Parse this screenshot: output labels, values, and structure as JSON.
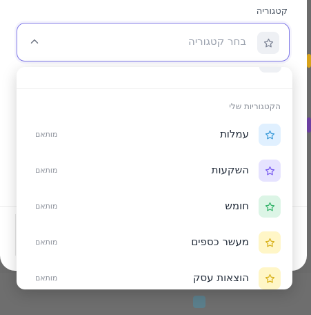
{
  "form": {
    "category_label": "קטגוריה",
    "placeholder": "בחר קטגוריה",
    "placeholder_icon": "star-icon",
    "chevron_icon": "chevron-up-icon",
    "accent_color": "#7b74e6"
  },
  "dropdown": {
    "section_title": "הקטגוריות שלי",
    "items": [
      {
        "label": "עמלות",
        "tag": "מותאם",
        "icon": "star-icon",
        "tile_color": "#e0f0ff",
        "star_color": "#3b9bd9"
      },
      {
        "label": "השקעות",
        "tag": "מותאם",
        "icon": "star-icon",
        "tile_color": "#e6e3ff",
        "star_color": "#7a5cf0"
      },
      {
        "label": "חומש",
        "tag": "מותאם",
        "icon": "star-icon",
        "tile_color": "#dcf5e6",
        "star_color": "#34b36a"
      },
      {
        "label": "מעשר כספים",
        "tag": "מותאם",
        "icon": "star-icon",
        "tile_color": "#fff6c7",
        "star_color": "#d8b11a"
      },
      {
        "label": "הוצאות עסק",
        "tag": "מותאם",
        "icon": "star-icon",
        "tile_color": "#fff6c7",
        "star_color": "#d8b11a"
      }
    ]
  }
}
